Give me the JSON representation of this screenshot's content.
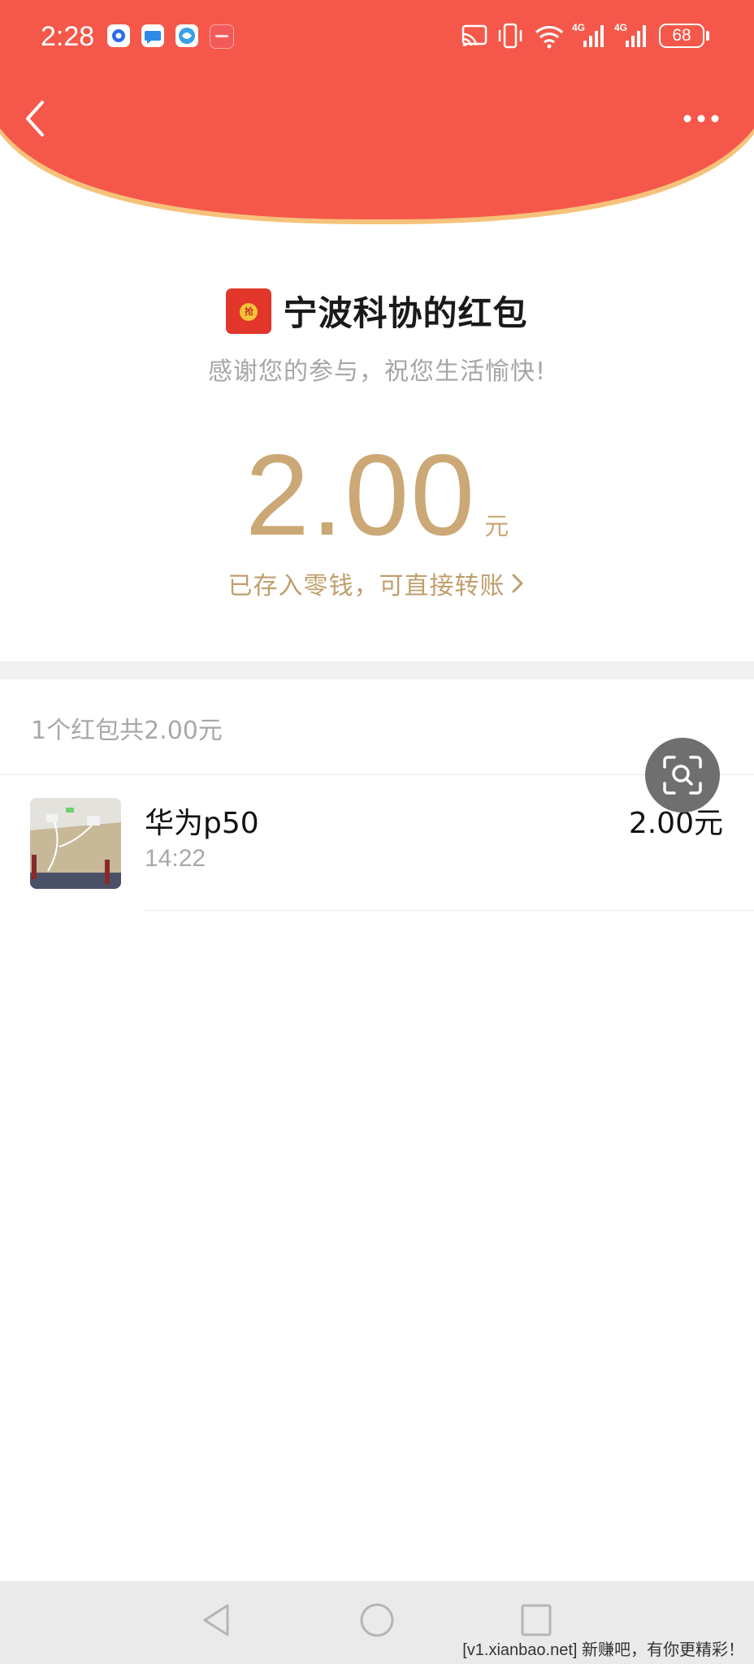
{
  "status_bar": {
    "time": "2:28",
    "battery": "68",
    "app_icons": [
      "notification-app-icon",
      "message-app-icon",
      "browser-app-icon",
      "huawei-app-icon"
    ],
    "right_icons": [
      "cast-icon",
      "vibrate-icon",
      "wifi-icon",
      "signal-4g-icon",
      "signal-4g-icon",
      "battery-icon"
    ]
  },
  "header": {
    "back_icon": "chevron-left-icon",
    "more_icon": "more-dots-icon",
    "colors": {
      "red": "#f5584a",
      "gold_edge": "#f6c27a"
    }
  },
  "envelope": {
    "icon": "red-envelope-icon",
    "coin_char": "抢",
    "title": "宁波科协的红包",
    "subtitle": "感谢您的参与，祝您生活愉快!"
  },
  "amount": {
    "value": "2.00",
    "unit": "元",
    "stored_text": "已存入零钱，可直接转账",
    "color": "#cba875"
  },
  "summary": {
    "text": "1个红包共2.00元"
  },
  "claims": [
    {
      "name": "华为p50",
      "time": "14:22",
      "amount": "2.00元",
      "avatar": "photo-avatar"
    }
  ],
  "floating": {
    "scan_icon": "scan-search-icon"
  },
  "bottom_nav": {
    "buttons": [
      "back-triangle-icon",
      "home-circle-icon",
      "recents-square-icon"
    ],
    "watermark": "[v1.xianbao.net] 新赚吧，有你更精彩！"
  }
}
